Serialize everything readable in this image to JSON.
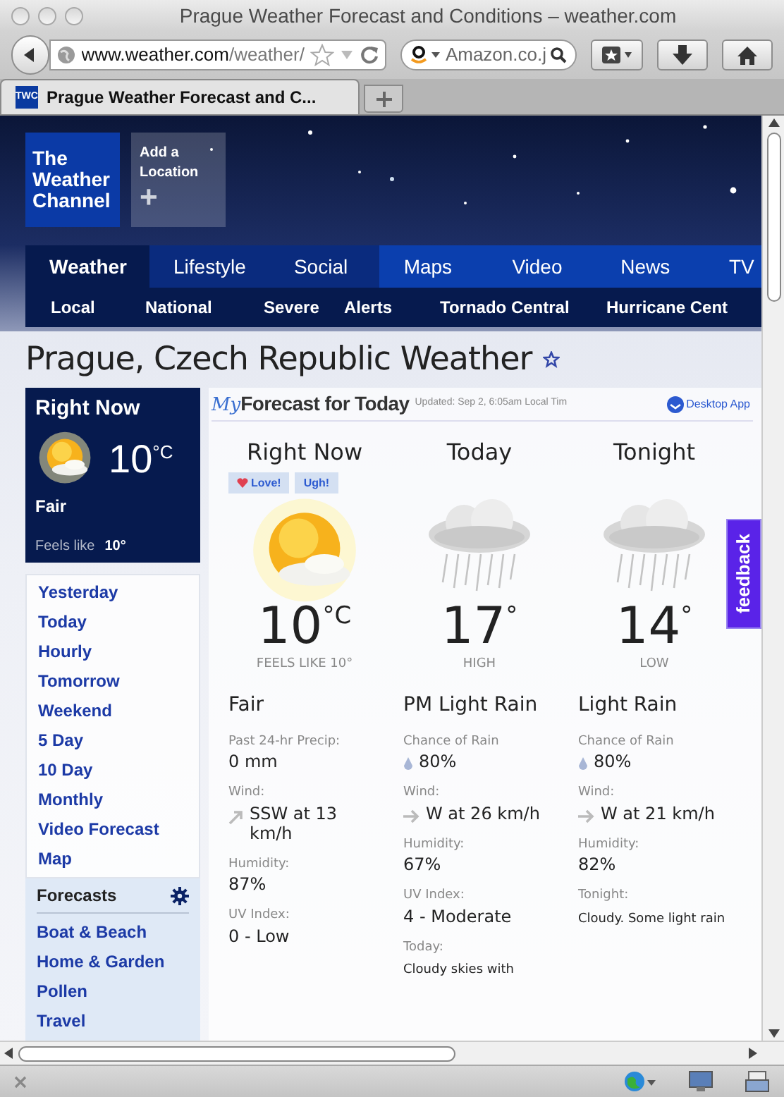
{
  "window": {
    "title": "Prague Weather Forecast and Conditions – weather.com"
  },
  "toolbar": {
    "address_host": "www.weather.com",
    "address_path": "/weather/",
    "search_engine_text": "Amazon.co.j"
  },
  "tabs": [
    {
      "label": "Prague Weather Forecast and C...",
      "favicon": "TWC",
      "selected": true
    }
  ],
  "header": {
    "logo": [
      "The",
      "Weather",
      "Channel"
    ],
    "add_location": "Add a Location",
    "add_symbol": "+"
  },
  "nav": [
    {
      "label": "Weather",
      "selected": true,
      "color": "#061a4e"
    },
    {
      "label": "Lifestyle",
      "selected": false,
      "color": "#0a2b7e"
    },
    {
      "label": "Social",
      "selected": false,
      "color": "#0a2b7e"
    },
    {
      "label": "Maps",
      "selected": false,
      "color": "#0b3fae"
    },
    {
      "label": "Video",
      "selected": false,
      "color": "#0b3fae"
    },
    {
      "label": "News",
      "selected": false,
      "color": "#0b3fae"
    },
    {
      "label": "TV",
      "selected": false,
      "color": "#0b3fae"
    }
  ],
  "subnav": [
    "Local",
    "National",
    "Severe",
    "Alerts",
    "Tornado Central",
    "Hurricane Cent"
  ],
  "page_title": "Prague, Czech Republic Weather",
  "right_now": {
    "title": "Right Now",
    "temp": "10",
    "unit": "°C",
    "condition": "Fair",
    "feels_label": "Feels like",
    "feels_value": "10°"
  },
  "sidebar": {
    "links": [
      "Yesterday",
      "Today",
      "Hourly",
      "Tomorrow",
      "Weekend",
      "5 Day",
      "10 Day",
      "Monthly",
      "Video Forecast",
      "Map"
    ],
    "section": "Forecasts",
    "section_links": [
      "Boat & Beach",
      "Home & Garden",
      "Pollen",
      "Travel"
    ]
  },
  "forecast": {
    "my": "My",
    "title": "Forecast for Today",
    "updated": "Updated: Sep 2, 6:05am Local Tim",
    "desktop_app": "Desktop App",
    "reactions": [
      {
        "label": "Love!",
        "kind": "love"
      },
      {
        "label": "Ugh!",
        "kind": "ugh"
      }
    ],
    "columns": [
      {
        "heading": "Right Now",
        "kind": "sun",
        "temp": "10",
        "unit": "°C",
        "sublabel": "FEELS LIKE 10°",
        "condition": "Fair",
        "stats": [
          {
            "label": "Past 24-hr Precip:",
            "value": "0 mm",
            "kind": "plain"
          },
          {
            "label": "Wind:",
            "value": "SSW at 13 km/h",
            "kind": "wind-ne"
          },
          {
            "label": "Humidity:",
            "value": "87%",
            "kind": "plain"
          },
          {
            "label": "UV Index:",
            "value": "0 - Low",
            "kind": "plain"
          }
        ]
      },
      {
        "heading": "Today",
        "kind": "rain",
        "temp": "17",
        "unit": "°",
        "sublabel": "HIGH",
        "condition": "PM Light Rain",
        "stats": [
          {
            "label": "Chance of Rain",
            "value": "80%",
            "kind": "drop"
          },
          {
            "label": "Wind:",
            "value": "W at 26 km/h",
            "kind": "wind-e"
          },
          {
            "label": "Humidity:",
            "value": "67%",
            "kind": "plain"
          },
          {
            "label": "UV Index:",
            "value": "4 - Moderate",
            "kind": "plain"
          },
          {
            "label": "Today:",
            "value": "Cloudy skies with",
            "kind": "note"
          }
        ]
      },
      {
        "heading": "Tonight",
        "kind": "rain",
        "temp": "14",
        "unit": "°",
        "sublabel": "LOW",
        "condition": "Light Rain",
        "stats": [
          {
            "label": "Chance of Rain",
            "value": "80%",
            "kind": "drop"
          },
          {
            "label": "Wind:",
            "value": "W at 21 km/h",
            "kind": "wind-e"
          },
          {
            "label": "Humidity:",
            "value": "82%",
            "kind": "plain"
          },
          {
            "label": "Tonight:",
            "value": "Cloudy. Some light rain",
            "kind": "note"
          }
        ]
      }
    ]
  },
  "feedback": "feedback"
}
